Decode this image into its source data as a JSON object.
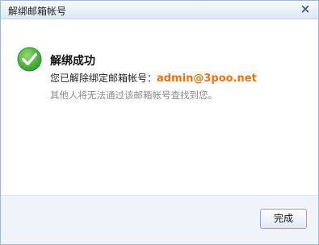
{
  "dialog": {
    "title": "解绑邮箱帐号",
    "close_symbol": "×"
  },
  "message": {
    "heading": "解绑成功",
    "line1_prefix": "您已解除绑定邮箱帐号：",
    "email": "admin@3poo.net",
    "line2": "其他人将无法通过该邮箱帐号查找到您。"
  },
  "footer": {
    "done_label": "完成"
  },
  "icons": {
    "success": "check-circle-icon",
    "close": "close-icon"
  },
  "colors": {
    "success_green": "#3aa53a",
    "email_orange": "#e8721c",
    "titlebar": "#dde8f3"
  }
}
